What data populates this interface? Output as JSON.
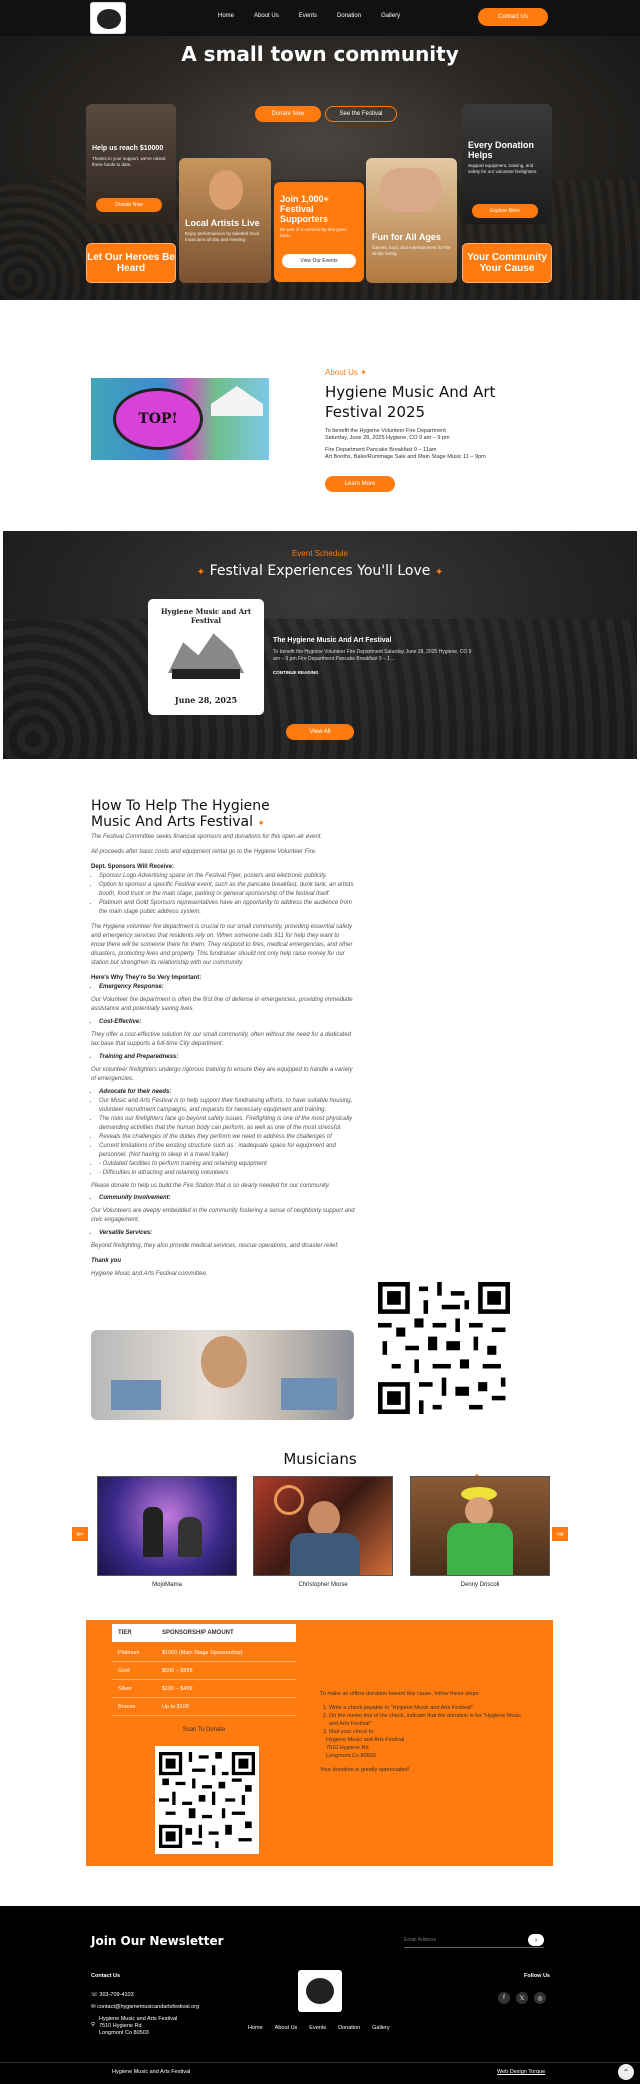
{
  "nav": {
    "links": [
      "Home",
      "About Us",
      "Events",
      "Donation",
      "Gallery"
    ],
    "cta": "Contact Us"
  },
  "hero": {
    "title": "A small town community",
    "donate_btn": "Donate Now",
    "see_btn": "See the Festival",
    "cards": {
      "reach_title": "Help us reach $10000",
      "reach_text": "Thanks to your support, we've raised these funds to date.",
      "reach_btn": "Donate Now",
      "heroes": "Let Our Heroes Be Heard",
      "artists_title": "Local Artists Live",
      "artists_text": "Enjoy performances by talented local musicians all day and evening.",
      "join_title": "Join 1,000+ Festival Supporters",
      "join_text": "Be part of a community that gives back.",
      "join_btn": "View Our Events",
      "fun_title": "Fun for All Ages",
      "fun_text": "Games, food, and entertainment for the whole family.",
      "helps_title": "Every Donation Helps",
      "helps_text": "Support equipment, training, and safety for our volunteer firefighters.",
      "helps_btn": "Explore More",
      "cause": "Your Community Your Cause"
    }
  },
  "about": {
    "eyebrow": "About Us",
    "title": "Hygiene Music And Art Festival 2025",
    "p1": "To benefit the Hygiene Volunteer Fire Department",
    "p2": "Saturday, June 28, 2025 Hygiene, CO 9 am – 9 pm",
    "p3": "Fire Department Pancake Breakfast 9 – 11am",
    "p4": "Art Booths, Bake/Rummage Sale and Main Stage Music 11 – 9pm",
    "btn": "Learn More",
    "sign_text": "TOP!"
  },
  "festival": {
    "eyebrow": "Event Schedule",
    "title": "Festival Experiences You'll Love",
    "event_title": "The Hygiene Music And Art Festival",
    "event_text": "To benefit the Hygiene Volunteer Fire Department Saturday June 28, 2025 Hygiene, CO 9 am – 9 pm Fire Department Pancake Breakfast 9 – 1…",
    "continue": "CONTINUE READING",
    "poster_top": "Hygiene Music and Art Festival",
    "poster_date": "June 28, 2025",
    "view_all": "View All"
  },
  "help": {
    "title": "How To Help The Hygiene Music And Arts Festival",
    "intro1": "The Festival Committee seeks financial sponsors and donations for this open-air event.",
    "intro2": "All proceeds after basic costs and equipment rental go to the Hygiene Volunteer Fire.",
    "spons_head": "Dept. Sponsors Will Receive:",
    "spons": [
      "Sponsor Logo Advertising space on the Festival Flyer, posters and electronic publicity.",
      "Option to sponsor a specific Festival event, such as the pancake breakfast, dunk tank, an artists booth, food truck or the main stage, parking or general sponsorship of the festival itself.",
      "Platinum and Gold Sponsors representatives have an opportunity to address the audience from the main stage public address system."
    ],
    "para1": "The Hygiene volunteer fire department is crucial to our small community, providing essential safety and emergency services that residents rely on. When someone calls 911 for help they want to know there will be someone there for them. They respond to fires, medical emergencies, and other disasters, protecting lives and property. This fundraiser should not only help raise money for our station but strengthen its relationship with our community.",
    "why_head": "Here's Why They're So Very Important:",
    "b_emergency": "Emergency Response:",
    "t_emergency": "Our Volunteer fire department is often the first line of defense in emergencies, providing immediate assistance and potentially saving lives.",
    "b_cost": "Cost-Effective:",
    "t_cost": "They offer a cost-effective solution for our small community, often without the need for a dedicated tax base that supports a full-time City department.",
    "b_training": "Training and Preparedness:",
    "t_training": "Our volunteer firefighters undergo rigorous training to ensure they are equipped to handle a variety of emergencies.",
    "b_advocate": "Advocate for their needs:",
    "advocate": [
      "Our Music and Arts Festival is to help support their fundraising efforts, to have suitable housing, volunteer recruitment campaigns, and requests for necessary equipment and training.",
      "The risks our firefighters face go beyond safety issues. Firefighting is one of the most physically demanding activities that the human body can perform, as well as one of the most stressful.",
      "Reveals the challenges of the duties they perform we need to address the challenges of",
      "Current limitations of the existing structure such as : inadequate space for equipment and personnel. (Not having to sleep in a travel trailer)",
      "- Outdated facilities to perform training and retaining equipment",
      "- Difficulties in attracting and retaining volunteers"
    ],
    "please": "Please donate to help us build the Fire Station that is so dearly needed for our community.",
    "b_community": "Community Involvement:",
    "t_community": "Our Volunteers are deeply embedded in the community fostering a sense of neighborly support and civic engagement.",
    "b_versatile": "Versatile Services:",
    "t_versatile": "Beyond firefighting, they also provide medical services, rescue operations, and disaster relief.",
    "thanks": "Thank you",
    "committee": "Hygiene Music and Arts Festival committee."
  },
  "musicians": {
    "title": "Musicians",
    "names": [
      "MojoMama",
      "Christopher Morse",
      "Denny Driscoll"
    ]
  },
  "sponsor": {
    "header_tier": "TIER",
    "header_amt": "SPONSORSHIP AMOUNT",
    "rows": [
      {
        "tier": "Platinum",
        "amt": "$1000 (Main Stage Sponsorship)"
      },
      {
        "tier": "Gold",
        "amt": "$500 – $999"
      },
      {
        "tier": "Silver",
        "amt": "$100 – $499"
      },
      {
        "tier": "Bronze",
        "amt": "Up to $100"
      }
    ],
    "scan": "Scan To Donate",
    "offline_head": "To make an offline donation toward this cause, follow these steps:",
    "steps": [
      "Write a check payable to \"Hygiene Music and Arts Festival\"",
      "On the memo line of the check, indicate that the donation is for \"Hygiene Music and Arts Festival\"",
      "Mail your check to:"
    ],
    "addr1": "Hygiene Music and Arts Festival",
    "addr2": "7510 Hygiene Rd",
    "addr3": "Longmont Co 80503",
    "apprec": "Your donation is greatly appreciated!"
  },
  "footer": {
    "newsletter": "Join Our Newsletter",
    "email_placeholder": "Email Address",
    "contact_head": "Contact Us",
    "phone": "303-709-4103",
    "email": "contact@hygienemusicandartsfestival.org",
    "addr1": "Hygiene Music and Arts Festival",
    "addr2": "7510 Hygiene Rd",
    "addr3": "Longmont Co 80503",
    "links": [
      "Home",
      "About Us",
      "Events",
      "Donation",
      "Gallery"
    ],
    "follow": "Follow Us",
    "copyright": "Hygiene Music and Arts Festival",
    "credit": "Web Design Torque"
  },
  "colors": {
    "accent": "#ff7b0f",
    "dark": "#111111"
  },
  "icons": [
    "phone-icon",
    "mail-icon",
    "location-icon",
    "facebook-icon",
    "x-icon",
    "instagram-icon",
    "sparkle-icon"
  ]
}
